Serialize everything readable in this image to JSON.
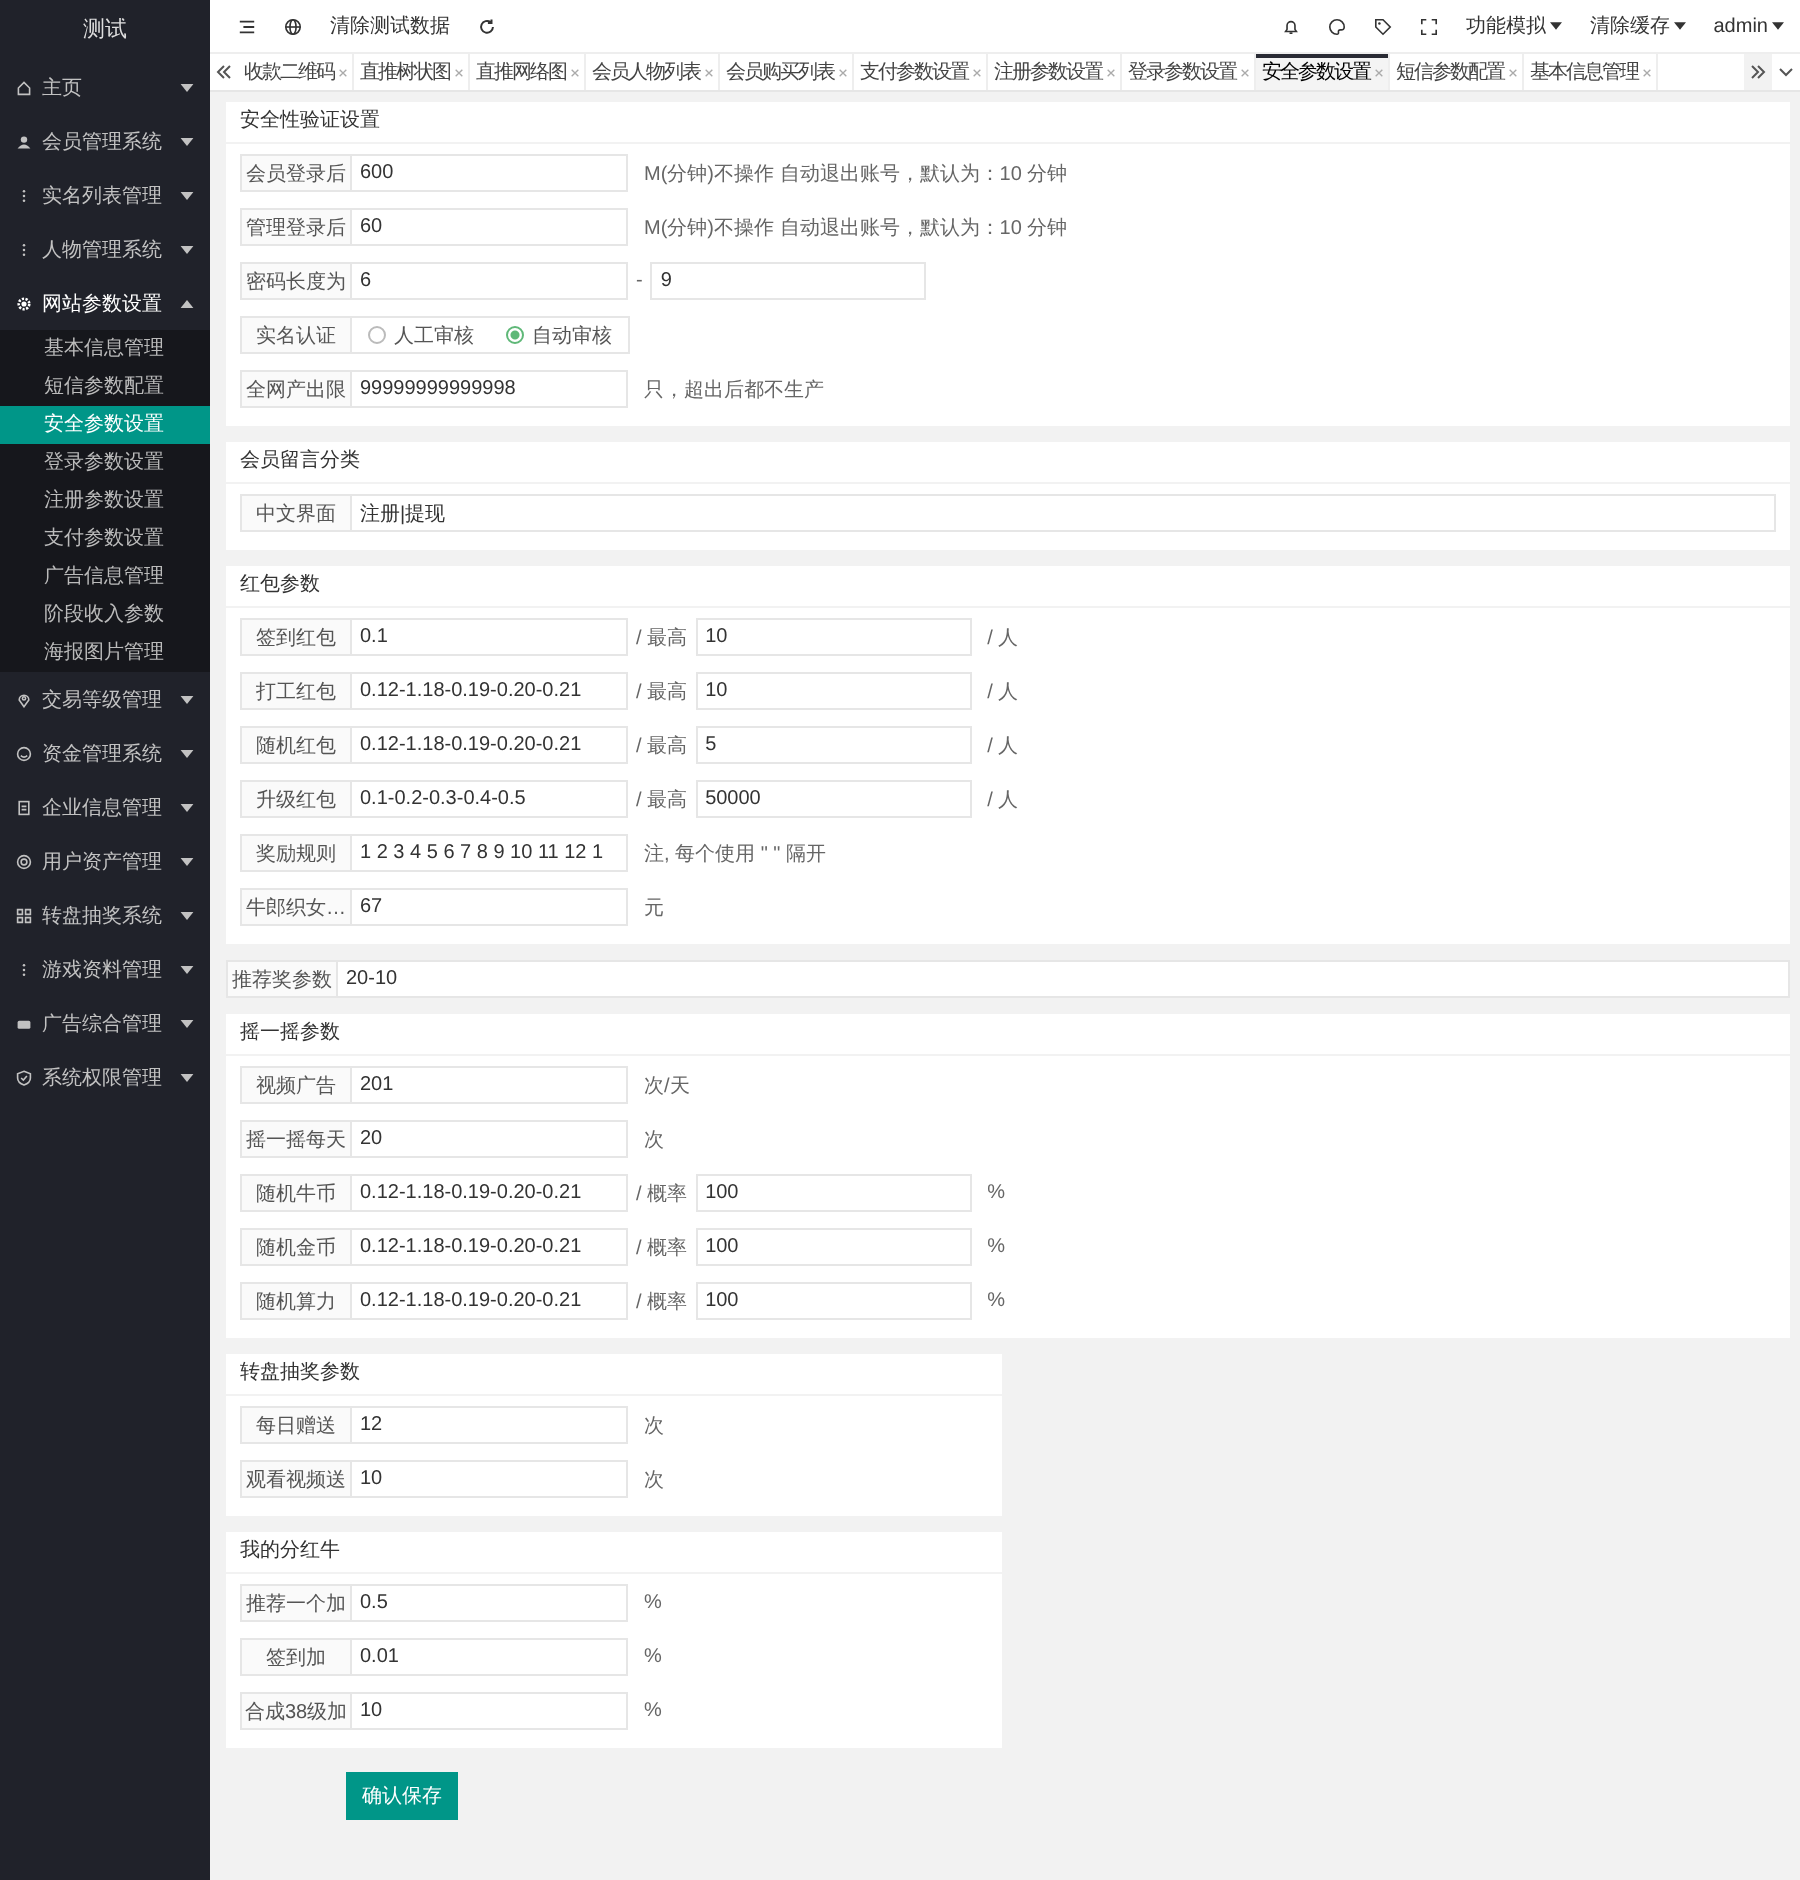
{
  "sidebar": {
    "title": "测试",
    "items": [
      {
        "label": "主页",
        "expanded": false
      },
      {
        "label": "会员管理系统",
        "expanded": false
      },
      {
        "label": "实名列表管理",
        "expanded": false
      },
      {
        "label": "人物管理系统",
        "expanded": false
      },
      {
        "label": "网站参数设置",
        "expanded": true,
        "children": [
          {
            "label": "基本信息管理",
            "selected": false
          },
          {
            "label": "短信参数配置",
            "selected": false
          },
          {
            "label": "安全参数设置",
            "selected": true
          },
          {
            "label": "登录参数设置",
            "selected": false
          },
          {
            "label": "注册参数设置",
            "selected": false
          },
          {
            "label": "支付参数设置",
            "selected": false
          },
          {
            "label": "广告信息管理",
            "selected": false
          },
          {
            "label": "阶段收入参数",
            "selected": false
          },
          {
            "label": "海报图片管理",
            "selected": false
          }
        ]
      },
      {
        "label": "交易等级管理",
        "expanded": false
      },
      {
        "label": "资金管理系统",
        "expanded": false
      },
      {
        "label": "企业信息管理",
        "expanded": false
      },
      {
        "label": "用户资产管理",
        "expanded": false
      },
      {
        "label": "转盘抽奖系统",
        "expanded": false
      },
      {
        "label": "游戏资料管理",
        "expanded": false
      },
      {
        "label": "广告综合管理",
        "expanded": false
      },
      {
        "label": "系统权限管理",
        "expanded": false
      }
    ]
  },
  "topbar": {
    "clear_button": "清除测试数据",
    "menus": [
      "功能模拟",
      "清除缓存",
      "admin"
    ]
  },
  "tabs": [
    {
      "label": "收款二维码",
      "selected": false
    },
    {
      "label": "直推树状图",
      "selected": false
    },
    {
      "label": "直推网络图",
      "selected": false
    },
    {
      "label": "会员人物列表",
      "selected": false
    },
    {
      "label": "会员购买列表",
      "selected": false
    },
    {
      "label": "支付参数设置",
      "selected": false
    },
    {
      "label": "注册参数设置",
      "selected": false
    },
    {
      "label": "登录参数设置",
      "selected": false
    },
    {
      "label": "安全参数设置",
      "selected": true
    },
    {
      "label": "短信参数配置",
      "selected": false
    },
    {
      "label": "基本信息管理",
      "selected": false
    }
  ],
  "sections": [
    {
      "title": "安全性验证设置",
      "rows": [
        {
          "kind": "field",
          "label": "会员登录后",
          "value": "600",
          "note": "M(分钟)不操作 自动退出账号，默认为：10 分钟"
        },
        {
          "kind": "field",
          "label": "管理登录后",
          "value": "60",
          "note": "M(分钟)不操作 自动退出账号，默认为：10 分钟"
        },
        {
          "kind": "pair",
          "label": "密码长度为",
          "value": "6",
          "unit": "-",
          "value2": "9"
        },
        {
          "kind": "radio",
          "label": "实名认证",
          "options": [
            {
              "label": "人工审核",
              "selected": false
            },
            {
              "label": "自动审核",
              "selected": true
            }
          ]
        },
        {
          "kind": "field",
          "label": "全网产出限",
          "value": "99999999999998",
          "note": "只，超出后都不生产"
        }
      ]
    },
    {
      "title": "会员留言分类",
      "rows": [
        {
          "kind": "wide",
          "label": "中文界面",
          "value": "注册|提现"
        }
      ]
    },
    {
      "title": "红包参数",
      "rows": [
        {
          "kind": "pair",
          "label": "签到红包",
          "value": "0.1",
          "unit": "/ 最高",
          "value2": "10",
          "note": "/ 人"
        },
        {
          "kind": "pair",
          "label": "打工红包",
          "value": "0.12-1.18-0.19-0.20-0.21",
          "unit": "/ 最高",
          "value2": "10",
          "note": "/ 人"
        },
        {
          "kind": "pair",
          "label": "随机红包",
          "value": "0.12-1.18-0.19-0.20-0.21",
          "unit": "/ 最高",
          "value2": "5",
          "note": "/ 人"
        },
        {
          "kind": "pair",
          "label": "升级红包",
          "value": "0.1-0.2-0.3-0.4-0.5",
          "unit": "/ 最高",
          "value2": "50000",
          "note": "/ 人"
        },
        {
          "kind": "field",
          "label": "奖励规则",
          "value": "1 2 3 4 5 6 7 8 9 10 11 12 1",
          "note": "注, 每个使用 \" \" 隔开"
        },
        {
          "kind": "field",
          "label": "牛郎织女…",
          "value": "67",
          "note": "元"
        }
      ]
    },
    {
      "rows": [
        {
          "kind": "wide",
          "label": "推荐奖参数",
          "value": "20-10"
        }
      ]
    },
    {
      "title": "摇一摇参数",
      "rows": [
        {
          "kind": "field",
          "label": "视频广告",
          "value": "201",
          "note": "次/天"
        },
        {
          "kind": "field",
          "label": "摇一摇每天",
          "value": "20",
          "note": "次"
        },
        {
          "kind": "pair",
          "label": "随机牛币",
          "value": "0.12-1.18-0.19-0.20-0.21",
          "unit": "/ 概率",
          "value2": "100",
          "note": "%"
        },
        {
          "kind": "pair",
          "label": "随机金币",
          "value": "0.12-1.18-0.19-0.20-0.21",
          "unit": "/ 概率",
          "value2": "100",
          "note": "%"
        },
        {
          "kind": "pair",
          "label": "随机算力",
          "value": "0.12-1.18-0.19-0.20-0.21",
          "unit": "/ 概率",
          "value2": "100",
          "note": "%"
        }
      ]
    },
    {
      "title": "转盘抽奖参数",
      "rows": [
        {
          "kind": "field",
          "label": "每日赠送",
          "value": "12",
          "note": "次"
        },
        {
          "kind": "field",
          "label": "观看视频送",
          "value": "10",
          "note": "次"
        }
      ]
    },
    {
      "title": "我的分红牛",
      "rows": [
        {
          "kind": "field",
          "label": "推荐一个加",
          "value": "0.5",
          "note": "%"
        },
        {
          "kind": "field",
          "label": "签到加",
          "value": "0.01",
          "note": "%"
        },
        {
          "kind": "field",
          "label": "合成38级加",
          "value": "10",
          "note": "%"
        }
      ]
    }
  ],
  "submit_button": "确认保存"
}
